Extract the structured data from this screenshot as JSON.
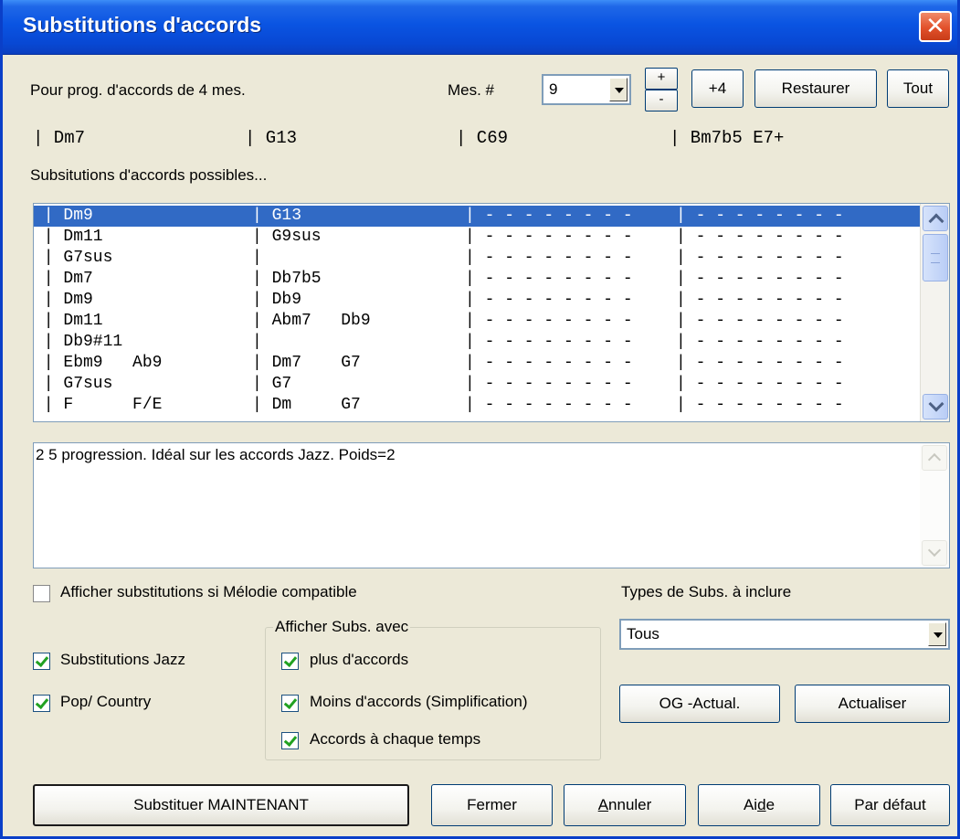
{
  "window": {
    "title": "Substitutions d'accords",
    "close_glyph": "✕"
  },
  "header": {
    "prog_label": "Pour prog. d'accords de 4 mes.",
    "mes_label": "Mes. #",
    "mes_value": "9",
    "spin_up": "+",
    "spin_down": "-",
    "plus4_label": "+4",
    "restore_label": "Restaurer",
    "all_label": "Tout"
  },
  "current_chords": [
    "|  Dm7",
    "|  G13",
    "|  C69",
    "|  Bm7b5    E7+"
  ],
  "list": {
    "caption": "Subsitutions d'accords possibles...",
    "rows": [
      {
        "c1": " | Dm9",
        "c2": "| G13",
        "c3": "| - - - - - - - -",
        "c4": "| - - - - - - - -"
      },
      {
        "c1": " | Dm11",
        "c2": "| G9sus",
        "c3": "| - - - - - - - -",
        "c4": "| - - - - - - - -"
      },
      {
        "c1": " | G7sus",
        "c2": "|",
        "c3": "| - - - - - - - -",
        "c4": "| - - - - - - - -"
      },
      {
        "c1": " | Dm7",
        "c2": "| Db7b5",
        "c3": "| - - - - - - - -",
        "c4": "| - - - - - - - -"
      },
      {
        "c1": " | Dm9",
        "c2": "| Db9",
        "c3": "| - - - - - - - -",
        "c4": "| - - - - - - - -"
      },
      {
        "c1": " | Dm11",
        "c2": "| Abm7   Db9",
        "c3": "| - - - - - - - -",
        "c4": "| - - - - - - - -"
      },
      {
        "c1": " | Db9#11",
        "c2": "|",
        "c3": "| - - - - - - - -",
        "c4": "| - - - - - - - -"
      },
      {
        "c1": " | Ebm9   Ab9",
        "c2": "| Dm7    G7",
        "c3": "| - - - - - - - -",
        "c4": "| - - - - - - - -"
      },
      {
        "c1": " | G7sus",
        "c2": "| G7",
        "c3": "| - - - - - - - -",
        "c4": "| - - - - - - - -"
      },
      {
        "c1": " | F      F/E",
        "c2": "| Dm     G7",
        "c3": "| - - - - - - - -",
        "c4": "| - - - - - - - -"
      }
    ],
    "selected_index": 0
  },
  "description": "2 5 progression.  Idéal sur les accords Jazz. Poids=2",
  "options": {
    "melody_compat_label": "Afficher substitutions si Mélodie compatible",
    "melody_compat_checked": false,
    "jazz_label": "Substitutions Jazz",
    "jazz_checked": true,
    "pop_label": "Pop/ Country",
    "pop_checked": true
  },
  "group": {
    "legend": "Afficher Subs. avec",
    "more_label": "plus d'accords",
    "less_label": "Moins d'accords (Simplification)",
    "each_beat_label": "Accords à chaque temps"
  },
  "types": {
    "label": "Types de Subs. à inclure",
    "value": "Tous"
  },
  "buttons": {
    "og_update": "OG -Actual.",
    "update": "Actualiser",
    "substitute_now": "Substituer MAINTENANT",
    "close": "Fermer",
    "cancel": "Annuler",
    "help": "Aide",
    "default": "Par défaut"
  },
  "colors": {
    "selection": "#316ac5",
    "titlebar": "#0a54e2",
    "dialog_bg": "#ece9d8"
  }
}
